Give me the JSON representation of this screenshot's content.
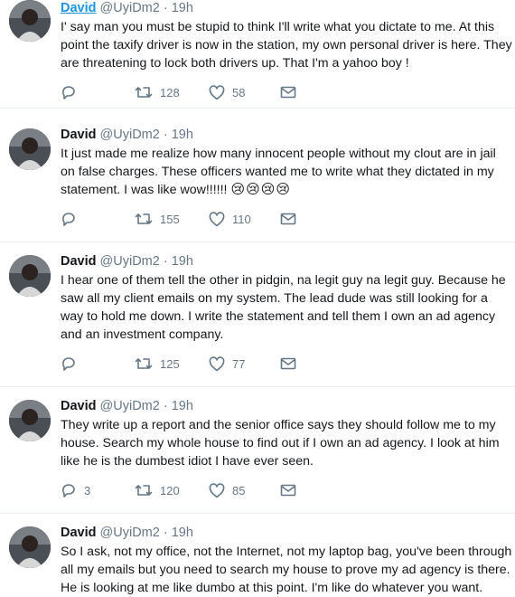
{
  "tweets": [
    {
      "name": "David",
      "handle": "@UyiDm2",
      "sep": "·",
      "time": "19h",
      "text": "I' say man you must be stupid to think I'll write what you dictate to me. At this point the taxify driver is now in the station, my own personal driver is here. They are threatening to lock both drivers up. That I'm a yahoo boy !",
      "emoji": "",
      "replies": "",
      "retweets": "128",
      "likes": "58"
    },
    {
      "name": "David",
      "handle": "@UyiDm2",
      "sep": "·",
      "time": "19h",
      "text": "It just made me realize how many innocent people without my clout are in jail on false charges. These officers wanted me to write what they dictated in my statement. I was like wow!!!!!! ",
      "emoji": "😢😢😢😢",
      "replies": "",
      "retweets": "155",
      "likes": "110"
    },
    {
      "name": "David",
      "handle": "@UyiDm2",
      "sep": "·",
      "time": "19h",
      "text": "I hear one of them tell the other in pidgin, na legit guy na legit guy. Because he saw all my client emails on my system. The lead dude was still looking for a way to hold me down. I write the statement and tell them I own an ad agency and an investment company.",
      "emoji": "",
      "replies": "",
      "retweets": "125",
      "likes": "77"
    },
    {
      "name": "David",
      "handle": "@UyiDm2",
      "sep": "·",
      "time": "19h",
      "text": "They write up a report and the senior office says they should follow me to my house. Search my whole house to find out if I own an ad agency. I look at him like he is the dumbest idiot I have ever seen.",
      "emoji": "",
      "replies": "3",
      "retweets": "120",
      "likes": "85"
    },
    {
      "name": "David",
      "handle": "@UyiDm2",
      "sep": "·",
      "time": "19h",
      "text": "So I ask, not my office, not the Internet, not my laptop bag, you've been through all my emails but you need to search my house to prove my ad agency is there. He is looking at me like dumbo at this point. I'm like do whatever you want.",
      "emoji": "",
      "replies": "",
      "retweets": "",
      "likes": ""
    }
  ],
  "icons": {
    "reply": "reply-icon",
    "retweet": "retweet-icon",
    "like": "heart-icon",
    "dm": "envelope-icon"
  },
  "colors": {
    "link": "#1b95e0",
    "muted": "#657786",
    "text": "#14171a",
    "divider": "#e6ecf0"
  }
}
